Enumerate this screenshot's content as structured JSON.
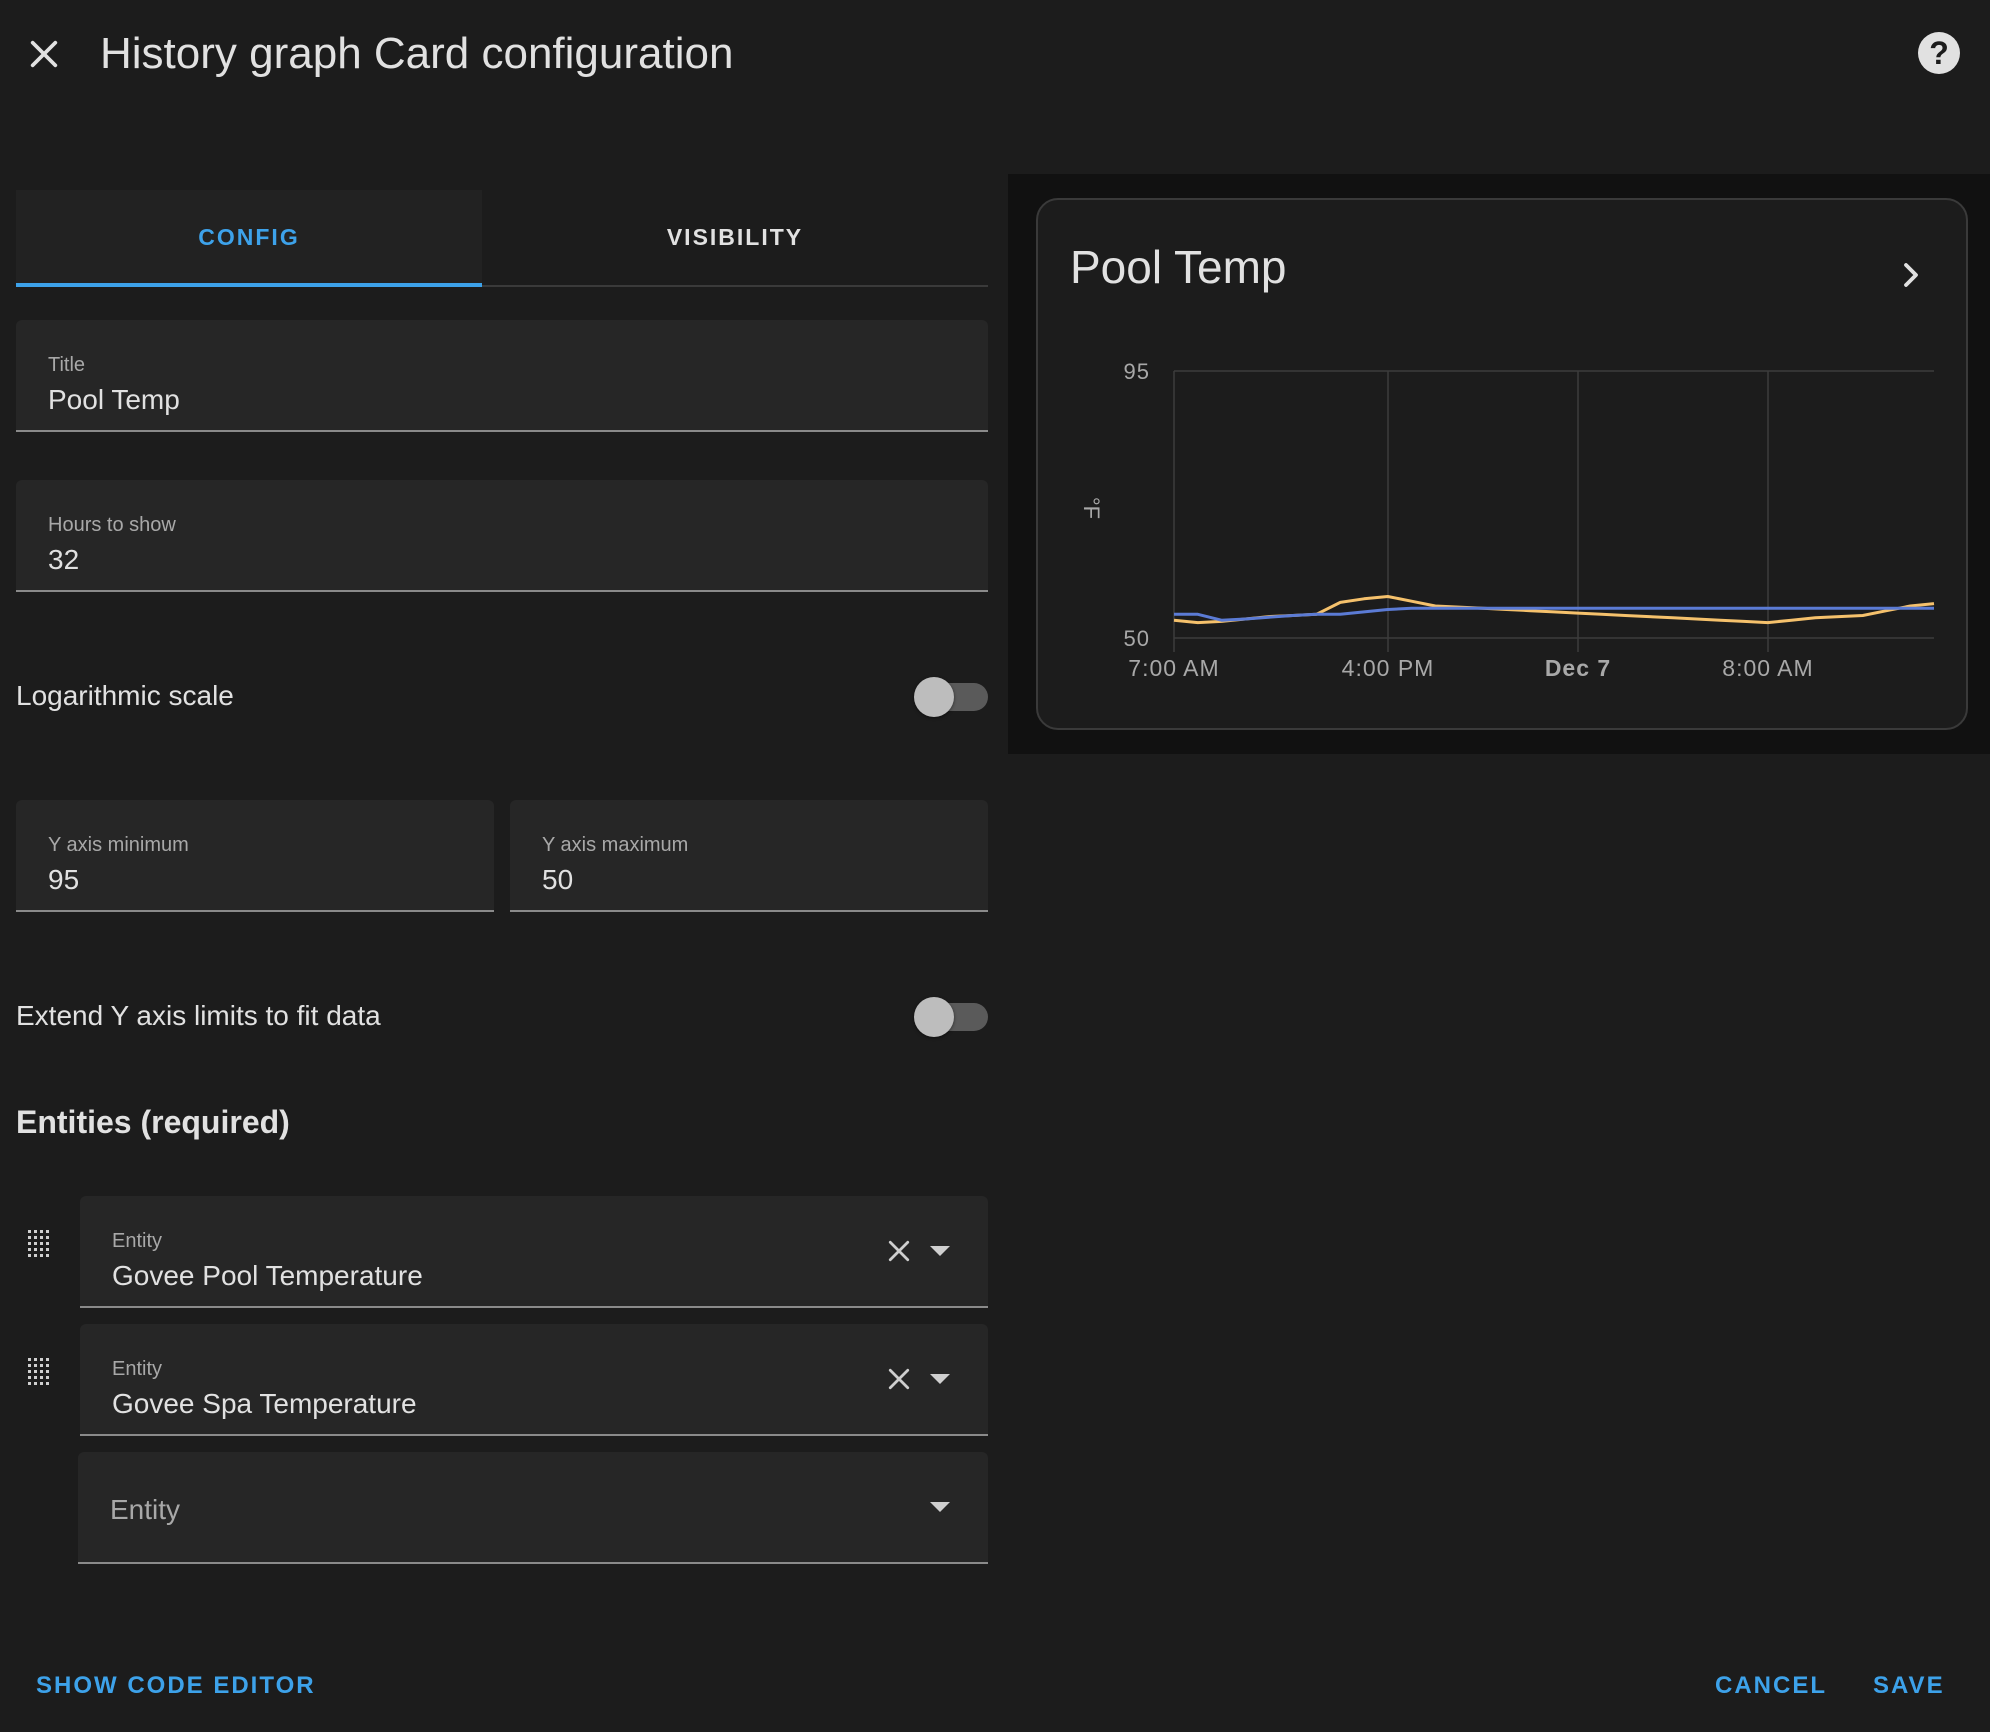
{
  "dialog": {
    "title": "History graph Card configuration",
    "close_icon": "close-icon",
    "help_icon": "help-circle-icon",
    "help_text": "?"
  },
  "tabs": [
    {
      "label": "CONFIG",
      "active": true
    },
    {
      "label": "VISIBILITY",
      "active": false
    }
  ],
  "fields": {
    "title": {
      "label": "Title",
      "value": "Pool Temp"
    },
    "hours_to_show": {
      "label": "Hours to show",
      "value": "32"
    },
    "y_min": {
      "label": "Y axis minimum",
      "value": "95"
    },
    "y_max": {
      "label": "Y axis maximum",
      "value": "50"
    }
  },
  "switches": {
    "log_scale": {
      "label": "Logarithmic scale",
      "on": false
    },
    "extend_y": {
      "label": "Extend Y axis limits to fit data",
      "on": false
    }
  },
  "entities": {
    "heading": "Entities (required)",
    "items": [
      {
        "label": "Entity",
        "value": "Govee Pool Temperature"
      },
      {
        "label": "Entity",
        "value": "Govee Spa Temperature"
      }
    ],
    "empty_placeholder": "Entity"
  },
  "footer": {
    "show_code_editor": "SHOW CODE EDITOR",
    "cancel": "CANCEL",
    "save": "SAVE"
  },
  "colors": {
    "accent": "#3da2ea",
    "series_pool": "#f5c16c",
    "series_spa": "#5b7bd5"
  },
  "preview": {
    "card_title": "Pool Temp",
    "chevron_icon": "chevron-right-icon"
  },
  "chart_data": {
    "type": "line",
    "title": "",
    "ylabel": "°F",
    "xlabel": "",
    "ylim": [
      50,
      95
    ],
    "y_ticks": [
      "95",
      "50"
    ],
    "x_ticks": [
      {
        "label": "7:00 AM",
        "bold": false
      },
      {
        "label": "4:00 PM",
        "bold": false
      },
      {
        "label": "Dec 7",
        "bold": true
      },
      {
        "label": "8:00 AM",
        "bold": false
      }
    ],
    "x": [
      0,
      1,
      2,
      3,
      4,
      5,
      6,
      7,
      8,
      9,
      10,
      11,
      12,
      13,
      14,
      15,
      16,
      17,
      18,
      19,
      20,
      21,
      22,
      23,
      24,
      25,
      26,
      27,
      28,
      29,
      30,
      31,
      32
    ],
    "series": [
      {
        "name": "",
        "color": "#f5c16c",
        "values": [
          53,
          52.6,
          52.8,
          53.2,
          53.6,
          53.8,
          54,
          56,
          56.6,
          57,
          56.2,
          55.4,
          55.2,
          55,
          54.8,
          54.6,
          54.4,
          54.2,
          54,
          53.8,
          53.6,
          53.4,
          53.2,
          53,
          52.8,
          52.6,
          53,
          53.4,
          53.6,
          53.8,
          54.6,
          55.4,
          55.8
        ]
      },
      {
        "name": "",
        "color": "#5b7bd5",
        "values": [
          54,
          54,
          53,
          53.2,
          53.5,
          53.8,
          54,
          54,
          54.4,
          54.8,
          55,
          55,
          55,
          55,
          55,
          55,
          55,
          55,
          55,
          55,
          55,
          55,
          55,
          55,
          55,
          55,
          55,
          55,
          55,
          55,
          55,
          55,
          55
        ]
      }
    ]
  }
}
